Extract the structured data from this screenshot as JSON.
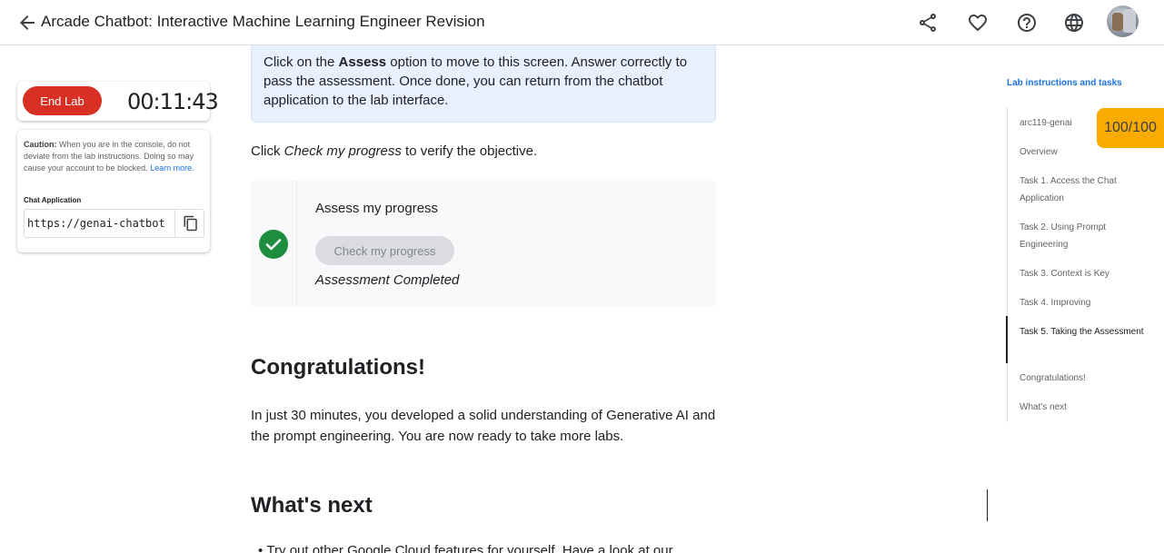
{
  "header": {
    "title": "Arcade Chatbot: Interactive Machine Learning Engineer Revision",
    "icons": [
      "arrow-back-icon",
      "share-icon",
      "heart-icon",
      "help-icon",
      "globe-icon",
      "avatar"
    ]
  },
  "lab_panel": {
    "end_lab_label": "End Lab",
    "timer": "00:11:43",
    "caution_label": "Caution:",
    "caution_text": "When you are in the console, do not deviate from the lab instructions. Doing so may cause your account to be blocked.",
    "learn_more": "Learn more.",
    "chat_app_label": "Chat Application",
    "chat_app_url": "https://genai-chatbot"
  },
  "content": {
    "note_part1": "Click on the ",
    "note_bold": "Assess",
    "note_part2": " option to move to this screen. Answer correctly to pass the assessment. Once done, you can return from the chatbot application to the lab interface.",
    "check_prefix": "Click ",
    "check_italic": "Check my progress",
    "check_suffix": " to verify the objective.",
    "assess_title": "Assess my progress",
    "check_button": "Check my progress",
    "assess_status": "Assessment Completed",
    "congrats_heading": "Congratulations!",
    "congrats_text": "In just 30 minutes, you developed a solid understanding of Generative AI and the prompt engineering. You are now ready to take more labs.",
    "next_heading": "What's next",
    "next_bullet": "Try out other Google Cloud features for yourself. Have a look at our"
  },
  "toc": {
    "heading": "Lab instructions and tasks",
    "score": "100/100",
    "items": [
      {
        "label": "arc119-genai"
      },
      {
        "label": "Overview"
      },
      {
        "label": "Task 1. Access the Chat Application"
      },
      {
        "label": "Task 2. Using Prompt Engineering"
      },
      {
        "label": "Task 3. Context is Key"
      },
      {
        "label": "Task 4. Improving"
      },
      {
        "label": "Task 5. Taking the Assessment"
      },
      {
        "label": "Congratulations!"
      },
      {
        "label": "What's next"
      }
    ],
    "active_item": "Task 5. Taking the Assessment"
  },
  "colors": {
    "end_lab": "#d93025",
    "success": "#1e8e3e",
    "link": "#1a73e8",
    "score_badge": "#f9ab00",
    "note_bg": "#e8f0fe"
  }
}
